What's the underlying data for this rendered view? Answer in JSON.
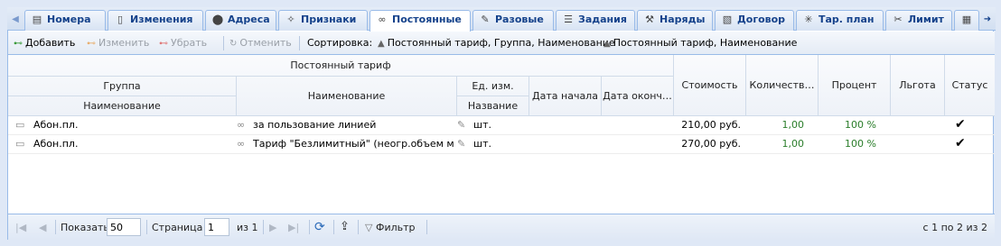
{
  "tabs": [
    {
      "label": "Номера",
      "icon": "sim-icon"
    },
    {
      "label": "Изменения",
      "icon": "document-icon"
    },
    {
      "label": "Адреса",
      "icon": "location-pin-icon"
    },
    {
      "label": "Признаки",
      "icon": "sparkle-icon"
    },
    {
      "label": "Постоянные",
      "icon": "link-icon"
    },
    {
      "label": "Разовые",
      "icon": "wrench-icon"
    },
    {
      "label": "Задания",
      "icon": "tasks-icon"
    },
    {
      "label": "Наряды",
      "icon": "tools-icon"
    },
    {
      "label": "Договор",
      "icon": "contract-icon"
    },
    {
      "label": "Тар. план",
      "icon": "tariff-plan-icon"
    },
    {
      "label": "Лимит",
      "icon": "scissors-icon"
    }
  ],
  "toolbar": {
    "add": "Добавить",
    "edit": "Изменить",
    "remove": "Убрать",
    "cancel": "Отменить",
    "sort_label": "Сортировка:",
    "sort1": "Постоянный тариф, Группа, Наименование",
    "sort2": "Постоянный тариф, Наименование"
  },
  "header": {
    "group_top": "Постоянный тариф",
    "group": "Группа",
    "group_name": "Наименование",
    "name": "Наименование",
    "unit": "Ед. изм.",
    "unit_name": "Название",
    "start": "Дата начала",
    "end": "Дата оконч…",
    "cost": "Стоимость",
    "qty": "Количеств…",
    "percent": "Процент",
    "benefit": "Льгота",
    "status": "Статус"
  },
  "rows": [
    {
      "group": "Абон.пл.",
      "name": "за пользование линией",
      "unit": "шт.",
      "cost": "210,00 руб.",
      "qty": "1,00",
      "percent": "100 %",
      "status": "✔"
    },
    {
      "group": "Абон.пл.",
      "name": "Тариф \"Безлимитный\" (неогр.объем ме…",
      "unit": "шт.",
      "cost": "270,00 руб.",
      "qty": "1,00",
      "percent": "100 %",
      "status": "✔"
    }
  ],
  "pager": {
    "show_label": "Показать",
    "page_size": "50",
    "page_label": "Страница",
    "page": "1",
    "of_label": "из 1",
    "filter": "Фильтр",
    "summary": "с 1 по 2 из 2"
  },
  "colors": {
    "accent": "#15428b",
    "border": "#99bbe8",
    "green": "#2a7d2a"
  }
}
